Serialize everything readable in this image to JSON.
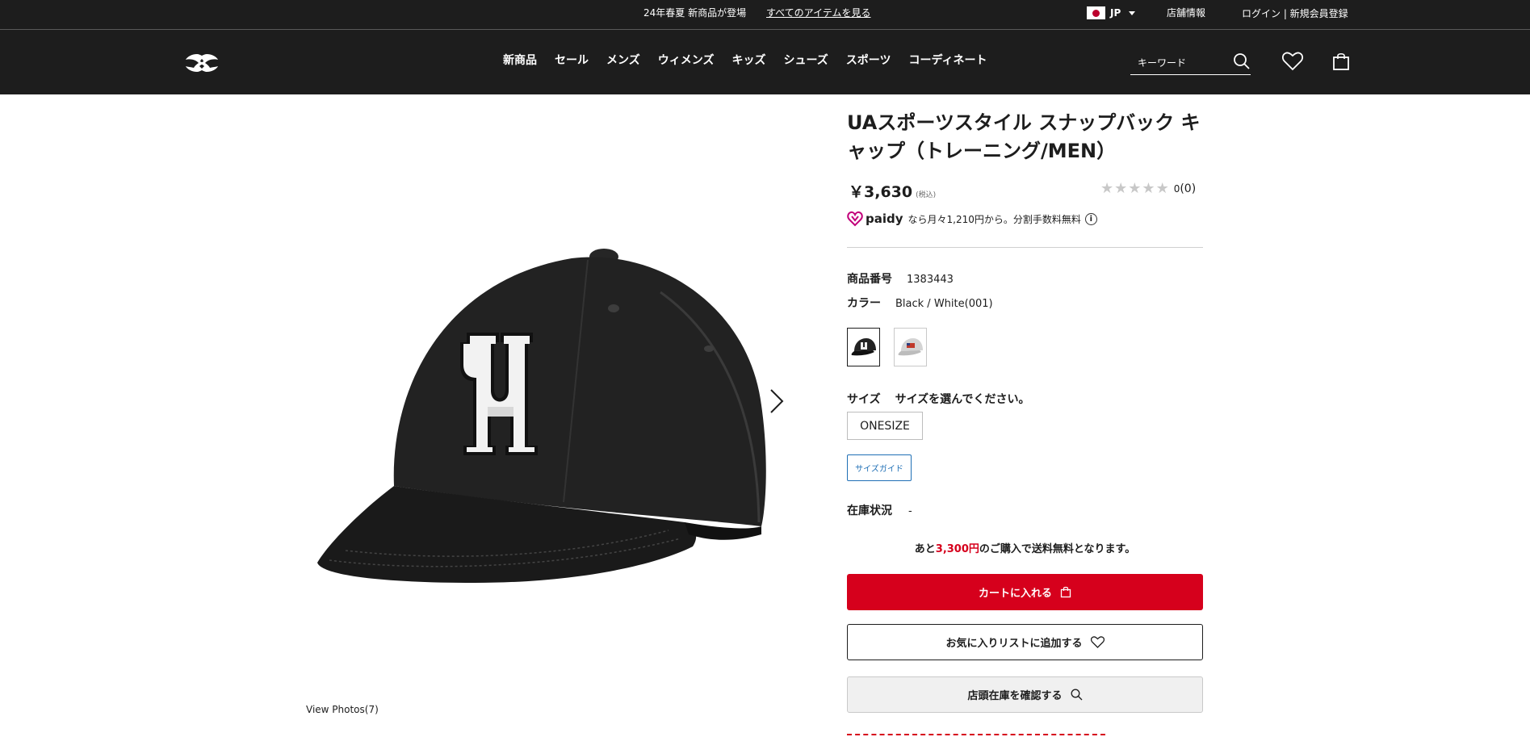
{
  "topbar": {
    "promo_text": "24年春夏 新商品が登場",
    "promo_link": "すべてのアイテムを見る",
    "language": "JP",
    "store_link": "店舗情報",
    "login_link": "ログイン | 新規会員登録"
  },
  "header": {
    "logo": "under-armour-logo",
    "nav": [
      "新商品",
      "セール",
      "メンズ",
      "ウィメンズ",
      "キッズ",
      "シューズ",
      "スポーツ",
      "コーディネート"
    ],
    "search_placeholder": "キーワード"
  },
  "gallery": {
    "view_photos": "View Photos(7)"
  },
  "product": {
    "title": "UAスポーツスタイル スナップバック キャップ（トレーニング/MEN）",
    "price": "￥3,630",
    "tax_label": "(税込)",
    "rating": {
      "stars": 0,
      "max_stars": 5,
      "average": "0",
      "count": "(0)"
    },
    "paidy": {
      "brand": "paidy",
      "text": "なら月々1,210円から。分割手数料無料"
    },
    "code_label": "商品番号",
    "code_value": "1383443",
    "color_label": "カラー",
    "color_value": "Black / White(001)",
    "size_label": "サイズ",
    "size_prompt": "サイズを選んでください。",
    "size_option": "ONESIZE",
    "size_guide": "サイズガイド",
    "stock_label": "在庫状況",
    "stock_value": "-",
    "shipping": {
      "prefix": "あと",
      "amount": "3,300円",
      "suffix": "のご購入で送料無料となります。"
    },
    "add_to_cart": "カートに入れる",
    "add_to_wishlist": "お気に入りリストに追加する",
    "check_store_stock": "店頭在庫を確認する"
  },
  "colors": {
    "brand_red": "#d6001c",
    "header_bg": "#1d1d1d",
    "link_blue": "#1f6fb5"
  }
}
